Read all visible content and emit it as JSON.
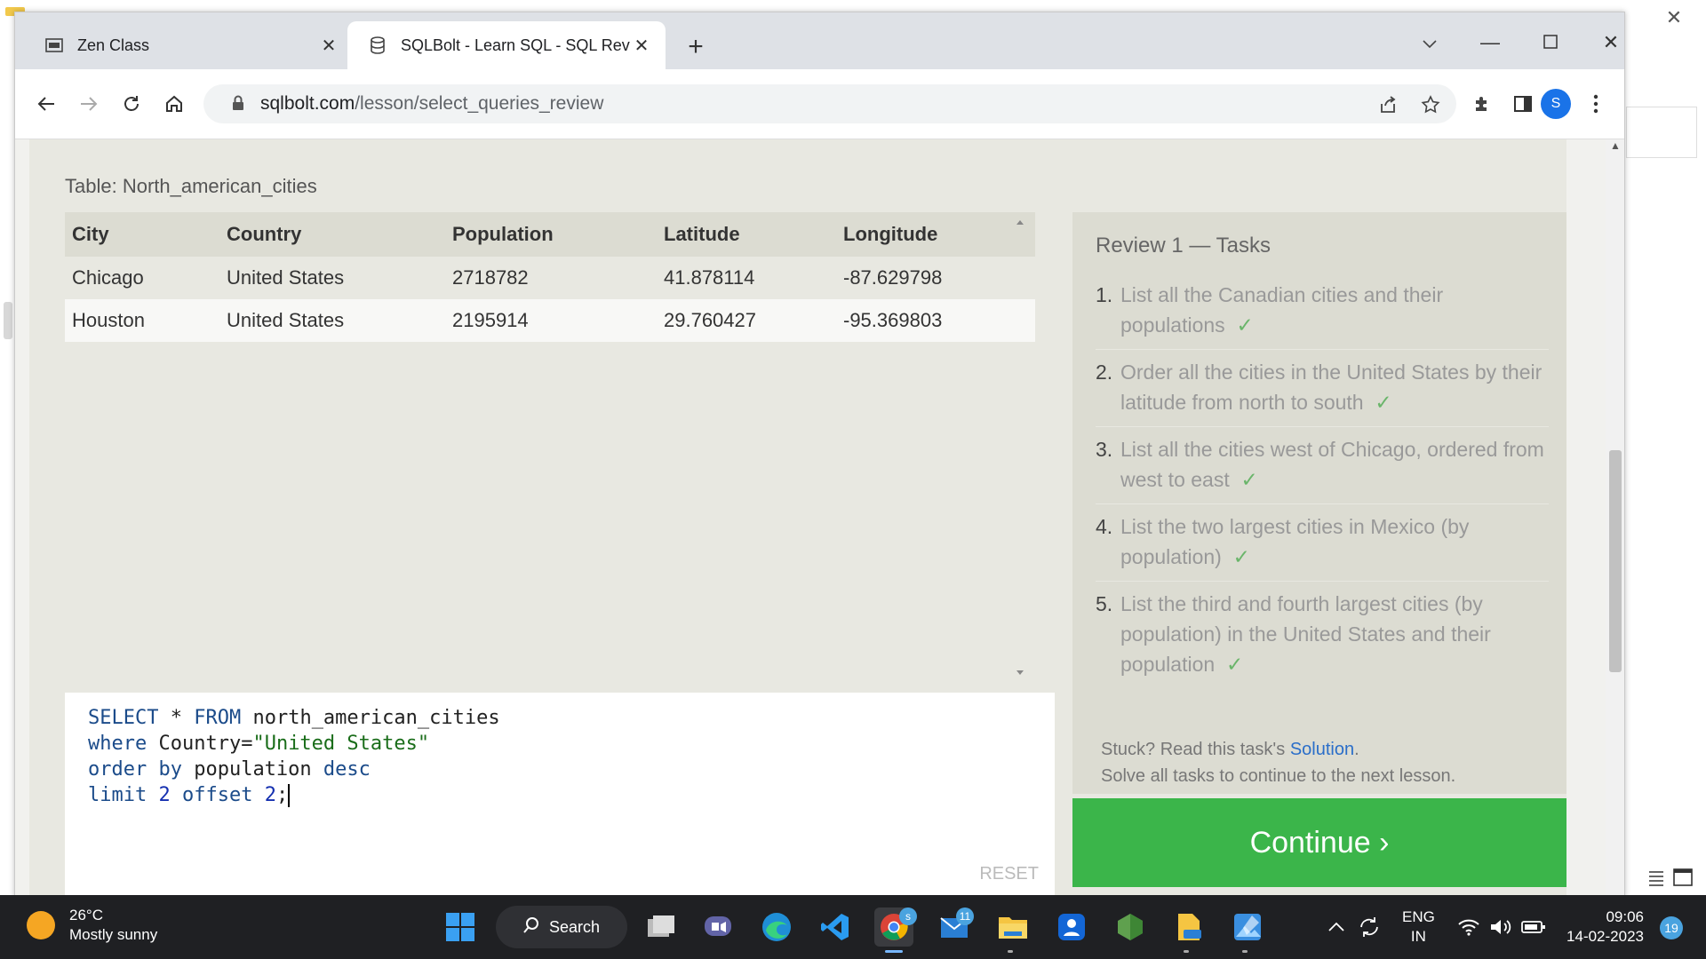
{
  "browser": {
    "tabs": [
      {
        "title": "Zen Class",
        "active": false
      },
      {
        "title": "SQLBolt - Learn SQL - SQL Review",
        "active": true
      }
    ],
    "url_domain": "sqlbolt.com",
    "url_path": "/lesson/select_queries_review",
    "profile_initial": "S"
  },
  "lesson": {
    "table_label": "Table: North_american_cities",
    "columns": [
      "City",
      "Country",
      "Population",
      "Latitude",
      "Longitude"
    ],
    "rows": [
      [
        "Chicago",
        "United States",
        "2718782",
        "41.878114",
        "-87.629798"
      ],
      [
        "Houston",
        "United States",
        "2195914",
        "29.760427",
        "-95.369803"
      ]
    ],
    "query_lines": [
      "SELECT * FROM north_american_cities",
      "where Country=\"United States\"",
      "order by population desc",
      "limit 2 offset 2;"
    ],
    "reset_label": "RESET",
    "tasks_title": "Review 1 — Tasks",
    "tasks": [
      {
        "num": "1.",
        "text": "List all the Canadian cities and their populations",
        "check": "✓"
      },
      {
        "num": "2.",
        "text": "Order all the cities in the United States by their latitude from north to south",
        "check": "✓"
      },
      {
        "num": "3.",
        "text": "List all the cities west of Chicago, ordered from west to east",
        "check": "✓"
      },
      {
        "num": "4.",
        "text": "List the two largest cities in Mexico (by population)",
        "check": "✓"
      },
      {
        "num": "5.",
        "text": "List the third and fourth largest cities (by population) in the United States and their population",
        "check": "✓"
      }
    ],
    "help_prefix": "Stuck? Read this task's ",
    "help_link": "Solution",
    "help_suffix": ".",
    "help_line2": "Solve all tasks to continue to the next lesson.",
    "continue_label": "Continue ›"
  },
  "taskbar": {
    "weather_temp": "26°C",
    "weather_desc": "Mostly sunny",
    "search_label": "Search",
    "mail_badge": "11",
    "lang_line1": "ENG",
    "lang_line2": "IN",
    "time": "09:06",
    "date": "14-02-2023",
    "notifications": "19"
  },
  "colors": {
    "continue": "#3bb54a",
    "keyword": "#1b4b8a",
    "string": "#1a6d1a",
    "check": "#6ab56a",
    "link": "#2a6ec9"
  }
}
